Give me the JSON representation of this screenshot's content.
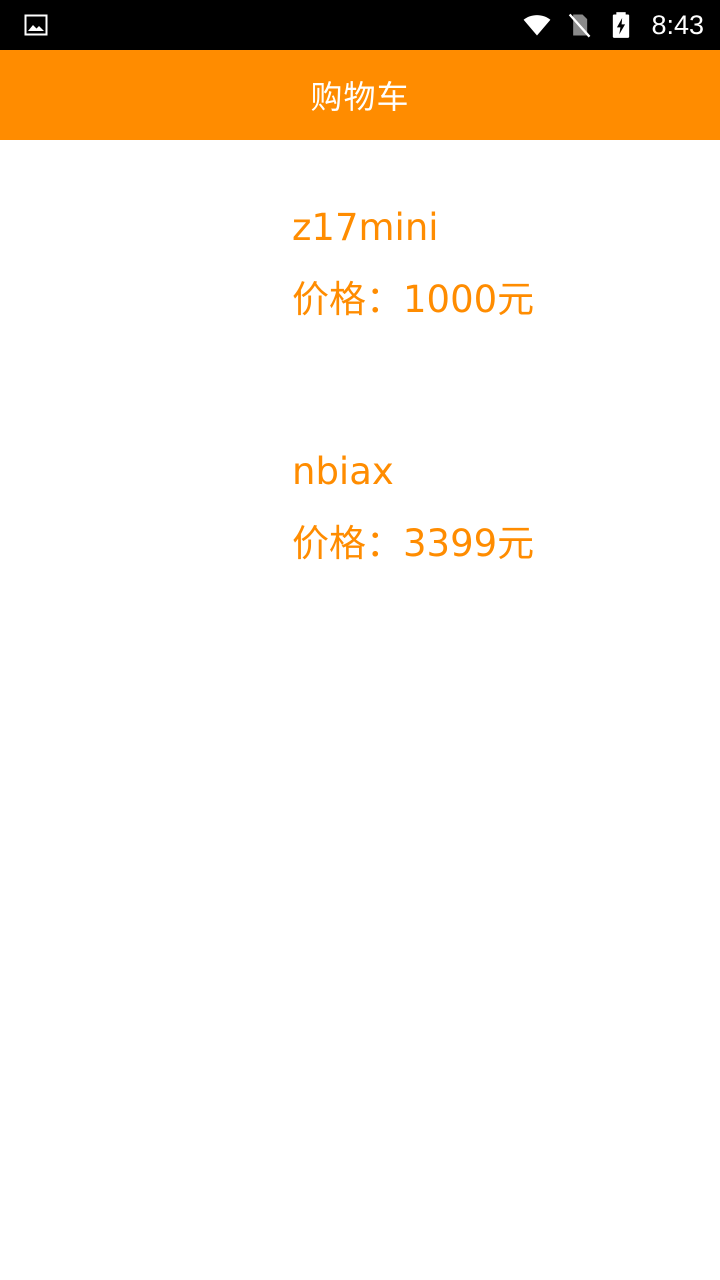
{
  "status_bar": {
    "time": "8:43",
    "icons": [
      "image-icon",
      "wifi-icon",
      "no-sim-icon",
      "battery-charging-icon"
    ]
  },
  "app_bar": {
    "title": "购物车",
    "color": "#ff8c00"
  },
  "cart": {
    "items": [
      {
        "name": "z17mini",
        "price": "价格：1000元"
      },
      {
        "name": "nbiax",
        "price": "价格：3399元"
      }
    ]
  },
  "colors": {
    "accent": "#ff8c00",
    "status_bar_bg": "#000000",
    "background": "#ffffff"
  }
}
